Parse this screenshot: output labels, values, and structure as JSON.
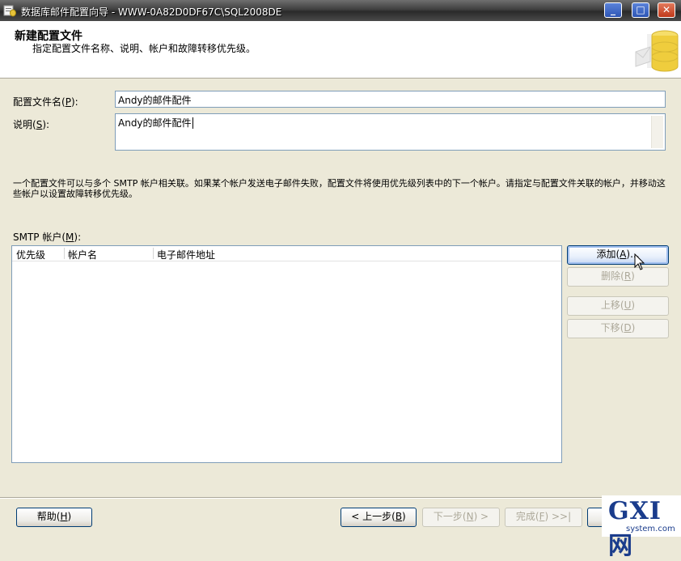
{
  "window": {
    "title": "数据库邮件配置向导 - WWW-0A82D0DF67C\\SQL2008DE",
    "minimize_glyph": "_",
    "maximize_glyph": "□",
    "close_glyph": "✕"
  },
  "header": {
    "title": "新建配置文件",
    "subtitle": "指定配置文件名称、说明、帐户和故障转移优先级。",
    "icon": "database-mail-icon"
  },
  "form": {
    "profile_name_label": "配置文件名",
    "profile_name_key": "P",
    "profile_name_value": "Andy的邮件配件",
    "description_label": "说明",
    "description_key": "S",
    "description_value": "Andy的邮件配件"
  },
  "info_text": "一个配置文件可以与多个 SMTP 帐户相关联。如果某个帐户发送电子邮件失败，配置文件将使用优先级列表中的下一个帐户。请指定与配置文件关联的帐户，并移动这些帐户以设置故障转移优先级。",
  "smtp": {
    "label": "SMTP 帐户",
    "key": "M",
    "columns": [
      "优先级",
      "帐户名",
      "电子邮件地址"
    ],
    "rows": []
  },
  "side_buttons": {
    "add": "添加",
    "add_key": "A",
    "remove": "删除",
    "remove_key": "R",
    "move_up": "上移",
    "move_up_key": "U",
    "move_down": "下移",
    "move_down_key": "D"
  },
  "footer": {
    "help": "帮助",
    "help_key": "H",
    "back": "< 上一步",
    "back_key": "B",
    "next": "下一步",
    "next_key": "N",
    "finish": "完成",
    "finish_key": "F"
  },
  "watermark": {
    "main": "GXI网",
    "sub": "system.com"
  },
  "colors": {
    "dialog_bg": "#ece9d8",
    "titlebar": "#3f3f3f",
    "field_border": "#7f9db9",
    "disabled_text": "#aca899"
  }
}
